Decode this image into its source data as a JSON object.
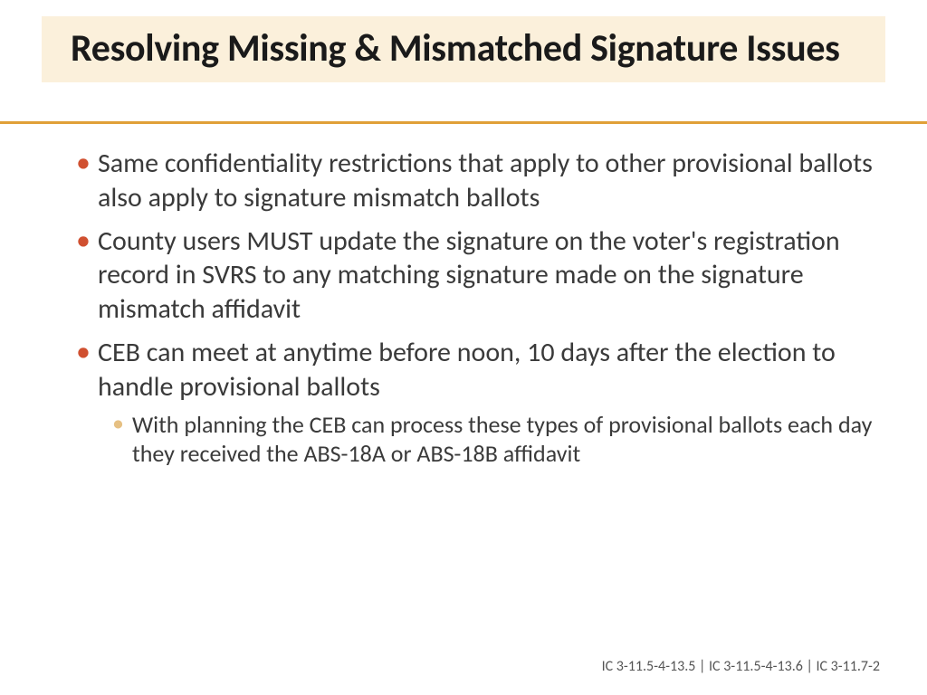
{
  "title": "Resolving Missing & Mismatched Signature Issues",
  "bullets": [
    {
      "text": "Same confidentiality restrictions that apply to other provisional ballots also apply to signature mismatch ballots"
    },
    {
      "text": "County users MUST update the signature on the voter's registration record in SVRS to any matching signature made on the signature mismatch affidavit"
    },
    {
      "text": "CEB can meet at anytime before noon, 10 days after the election to handle provisional ballots",
      "sub": [
        "With planning the CEB can process these types of provisional ballots each day they received the ABS-18A or ABS-18B affidavit"
      ]
    }
  ],
  "footer": "IC 3-11.5-4-13.5 | IC 3-11.5-4-13.6 | IC 3-11.7-2"
}
